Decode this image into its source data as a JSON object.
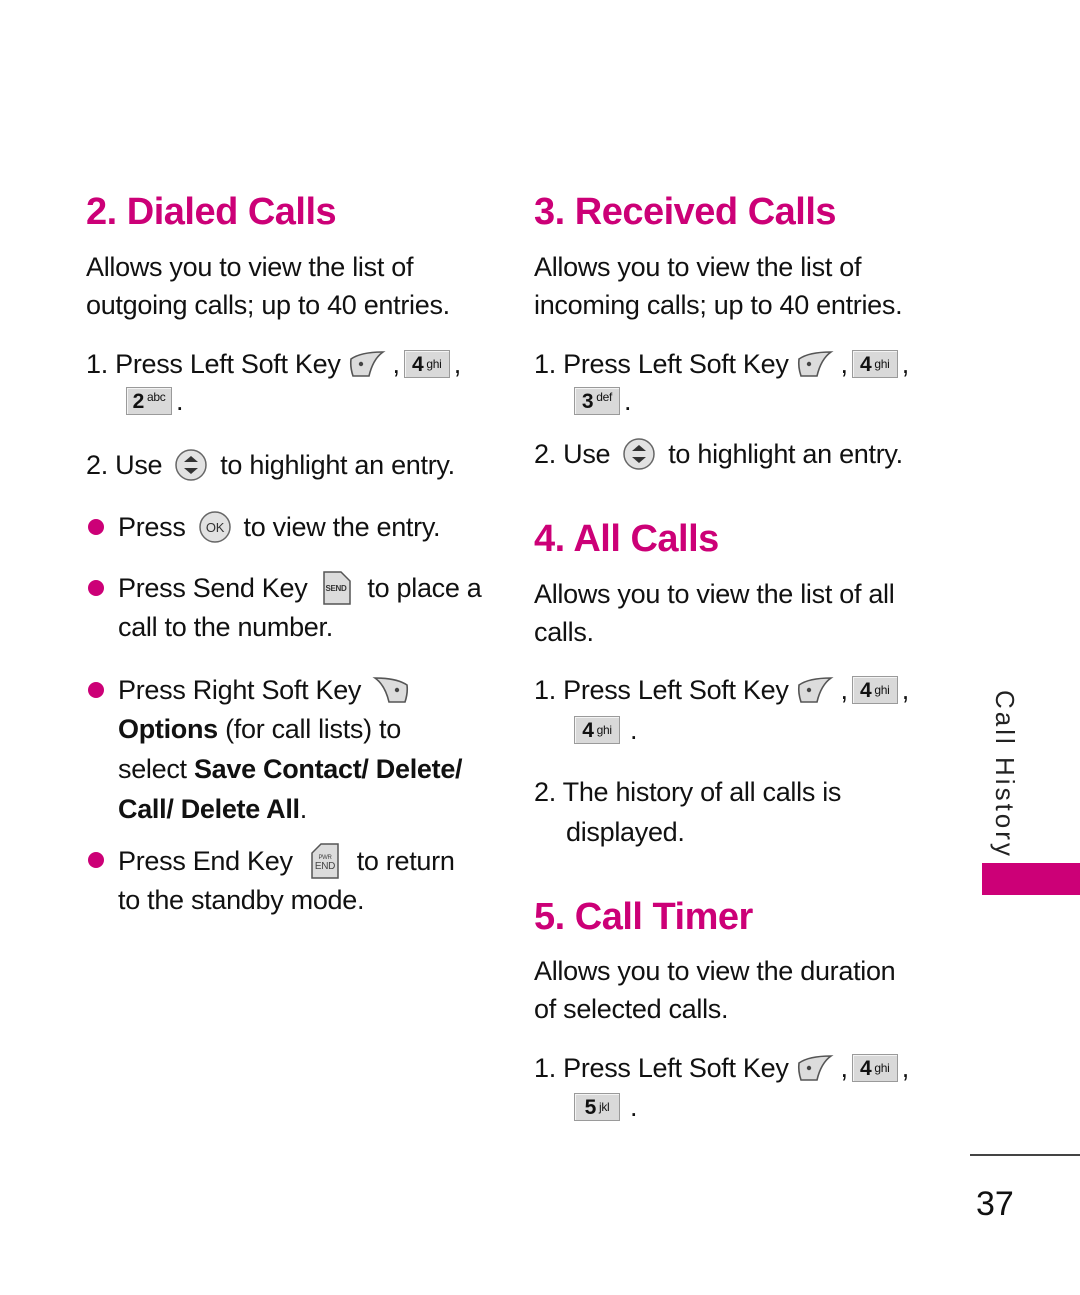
{
  "page": {
    "section_label": "Call History",
    "page_number": "37",
    "accent_color": "#cc0077"
  },
  "keys": {
    "left_soft": "left-soft-key-icon",
    "right_soft": "right-soft-key-icon",
    "nav": "navigation-key-icon",
    "ok": "OK",
    "send": "SEND",
    "end_top": "PWR",
    "end_bottom": "END",
    "k4": {
      "num": "4",
      "letters": "ghi"
    },
    "k2": {
      "num": "2",
      "letters": "abc"
    },
    "k3": {
      "num": "3",
      "letters": "def"
    },
    "k5": {
      "num": "5",
      "letters": "jkl"
    }
  },
  "dialed": {
    "title": "2. Dialed Calls",
    "desc_line1": "Allows you to view the list of",
    "desc_line2": "outgoing calls; up to 40 entries.",
    "step1_prefix": "1. Press Left Soft Key",
    "comma": ",",
    "period": ".",
    "step2_prefix": "2.  Use",
    "step2_suffix": "to highlight an entry.",
    "b1_prefix": "Press",
    "b1_suffix": "to view the entry.",
    "b2_prefix": "Press Send Key",
    "b2_suffix": "to place a",
    "b2_line2": "call to the number.",
    "b3_prefix": "Press Right Soft Key",
    "b3_options": "Options",
    "b3_rest1": " (for call lists) to",
    "b3_select": "select ",
    "b3_save": "Save Contact/ Delete/",
    "b3_line4": "Call/ Delete All",
    "b3_period": ".",
    "b4_prefix": "Press End Key",
    "b4_suffix": "to return",
    "b4_line2": "to the standby mode."
  },
  "received": {
    "title": "3. Received Calls",
    "desc_line1": "Allows you to view the list of",
    "desc_line2": "incoming calls; up to 40 entries.",
    "step1_prefix": "1. Press Left Soft Key",
    "step2_prefix": "2. Use",
    "step2_suffix": "to highlight an entry."
  },
  "all": {
    "title": "4. All Calls",
    "desc_line1": "Allows you to view the list of all",
    "desc_line2": "calls.",
    "step1_prefix": "1. Press Left Soft Key",
    "step2_line1": "2. The history of all calls is",
    "step2_line2": "displayed."
  },
  "timer": {
    "title": "5. Call Timer",
    "desc_line1": "Allows you to view the duration",
    "desc_line2": "of selected calls.",
    "step1_prefix": "1. Press Left Soft Key"
  }
}
